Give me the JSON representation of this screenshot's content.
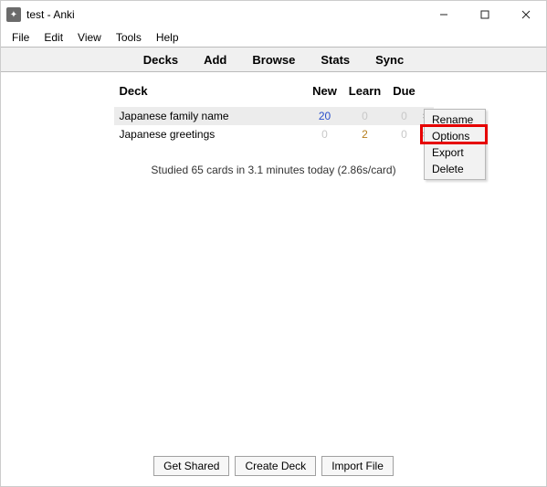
{
  "window": {
    "title": "test - Anki"
  },
  "menubar": {
    "items": [
      "File",
      "Edit",
      "View",
      "Tools",
      "Help"
    ]
  },
  "toolbar": {
    "tabs": [
      "Decks",
      "Add",
      "Browse",
      "Stats",
      "Sync"
    ]
  },
  "decklist": {
    "headers": {
      "deck": "Deck",
      "new": "New",
      "learn": "Learn",
      "due": "Due"
    },
    "rows": [
      {
        "name": "Japanese family name",
        "new": "20",
        "learn": "0",
        "due": "0",
        "selected": true
      },
      {
        "name": "Japanese greetings",
        "new": "0",
        "learn": "2",
        "due": "0",
        "selected": false
      }
    ]
  },
  "study_summary": "Studied 65 cards in 3.1 minutes today (2.86s/card)",
  "context_menu": {
    "items": [
      "Rename",
      "Options",
      "Export",
      "Delete"
    ],
    "highlighted": "Options"
  },
  "footer": {
    "get_shared": "Get Shared",
    "create_deck": "Create Deck",
    "import_file": "Import File"
  }
}
